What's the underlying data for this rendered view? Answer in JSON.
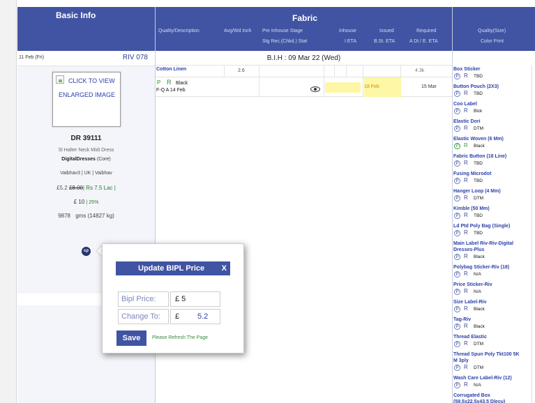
{
  "header": {
    "basic_info": "Basic Info",
    "fabric": "Fabric",
    "fabric_cols": {
      "quality": "Quality/Description",
      "avg_wd": "Avg/Wd Inch",
      "pre_inhouse": "Pre Inhouse Stage",
      "stg_rec": "Stg Rec.(Chkd.) Stat",
      "inhouse": "Inhouse",
      "ieta": "I ETA",
      "issued": "Issued",
      "bst_eta": "B.St. ETA",
      "required": "Required",
      "adt_eta": "A Dt / E. ETA"
    },
    "trims_cols": {
      "quality_size": "Quality(Size)",
      "color_print": "Color Print"
    }
  },
  "basic": {
    "date": "11 Feb (Fri)",
    "riv": "RIV 078",
    "thumb_line1": "CLICK TO VIEW",
    "thumb_line2": "ENLARGED IMAGE",
    "style_code": "DR 39111",
    "style_desc": "Sl Halter Neck Midi Dress",
    "category": "DigitalDresses",
    "category_suffix": "(Core)",
    "team": "Vaibhav3  | UK |  Vaibhav",
    "price_gbp": "£5.2",
    "price_old": "£8.00",
    "price_rs": "| Rs 7.5 Lac |",
    "margin_val": "£ 10",
    "margin_pct": "| 25%",
    "weight_gms": "9878",
    "weight_total": "gms (14827 kg)",
    "cp_label": "cp"
  },
  "fabric": {
    "bih": "B.I.H : 09 Mar 22 (Wed)",
    "row1": {
      "name": "Cotton Linen",
      "avg": "2.6",
      "required": "4.3k"
    },
    "row2": {
      "p": "P",
      "r": "R",
      "color": "Black",
      "fqa": "F-Q A 14 Feb",
      "issued_date": "18 Feb",
      "required_date": "15 Mar"
    }
  },
  "trims": [
    {
      "name": "Box Sticker",
      "p": "P",
      "r": "R",
      "value": "TBD",
      "green": false
    },
    {
      "name": "Button Pouch (2X3)",
      "p": "P",
      "r": "R",
      "value": "TBD",
      "green": false
    },
    {
      "name": "Coo Label",
      "p": "P",
      "r": "R",
      "value": "Blck",
      "green": false
    },
    {
      "name": "Elastic Dori",
      "p": "P",
      "r": "R",
      "value": "DTM",
      "green": false
    },
    {
      "name": "Elastic Woven (6 Mm)",
      "p": "P",
      "r": "R",
      "value": "Black",
      "green": true
    },
    {
      "name": "Fabric Button (18 Line)",
      "p": "P",
      "r": "R",
      "value": "TBD",
      "green": false
    },
    {
      "name": "Fusing Microdot",
      "p": "P",
      "r": "R",
      "value": "TBD",
      "green": false
    },
    {
      "name": "Hanger Loop (4 Mm)",
      "p": "P",
      "r": "R",
      "value": "DTM",
      "green": false
    },
    {
      "name": "Kimble (50 Mm)",
      "p": "P",
      "r": "R",
      "value": "TBD",
      "green": false
    },
    {
      "name": "Ld Ptd Poly Bag (Single)",
      "p": "P",
      "r": "R",
      "value": "TBD",
      "green": false
    },
    {
      "name": "Main Label Riv-Riv-Digital",
      "name2": "Dresses-Plus",
      "p": "P",
      "r": "R",
      "value": "Black",
      "green": false
    },
    {
      "name": "Polybag Sticker-Riv (18)",
      "p": "P",
      "r": "R",
      "value": "N/A",
      "green": false
    },
    {
      "name": "Price Sticker-Riv",
      "p": "P",
      "r": "R",
      "value": "N/A",
      "green": false
    },
    {
      "name": "Size Label-Riv",
      "p": "P",
      "r": "R",
      "value": "Black",
      "green": false
    },
    {
      "name": "Tag-Riv",
      "p": "P",
      "r": "R",
      "value": "Black",
      "green": false
    },
    {
      "name": "Thread Elastic",
      "p": "P",
      "r": "R",
      "value": "DTM",
      "green": false
    },
    {
      "name": "Thread Spun Poly Tkt100 5K",
      "name2": "M 3ply",
      "p": "P",
      "r": "R",
      "value": "DTM",
      "green": false
    },
    {
      "name": "Wash Care Label-Riv (12)",
      "p": "P",
      "r": "R",
      "value": "N/A",
      "green": false
    },
    {
      "name": "Corrugated Box",
      "name2": "(59.5x22.5x43.5 Dlecu)",
      "p": "",
      "r": "",
      "value": "",
      "green": false
    }
  ],
  "popup": {
    "title": "Update BIPL Price",
    "close": "X",
    "bipl_label": "Bipl Price:",
    "bipl_value": "£ 5",
    "change_label": "Change To:",
    "currency": "£",
    "change_value": "5.2",
    "save": "Save",
    "note": "Please Refresh The Page"
  }
}
